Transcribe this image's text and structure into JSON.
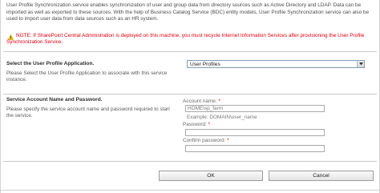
{
  "intro_text": "User Profile Synchronization service enables synchronization of user and group data from directory sources such as Active Directory and LDAP. Data can be imported as well as exported to these sources. With the help of Business Catalog Service (BDC) entity models, User Profile Synchronization service can also be used to import user data from data sources such as an HR system.",
  "note_text": "NOTE: If SharePoint Central Administration is deployed on this machine, you must recycle Internet Information Services after provisioning the User Profile Synchronization Service.",
  "app_section": {
    "title": "Select the User Profile Application.",
    "description": "Please Select the User Profile Application to associate with this service instance.",
    "selected": "User Profiles"
  },
  "account_section": {
    "title": "Service Account Name and Password.",
    "description": "Please specify the service account name and password required to start the service.",
    "account_label": "Account name:",
    "required_mark": "*",
    "account_value": "HOME\\sp_farm",
    "example": "Example: DOMAIN\\user_name",
    "password_label": "Password:",
    "confirm_label": "Confirm password:"
  },
  "buttons": {
    "ok": "OK",
    "cancel": "Cancel"
  }
}
